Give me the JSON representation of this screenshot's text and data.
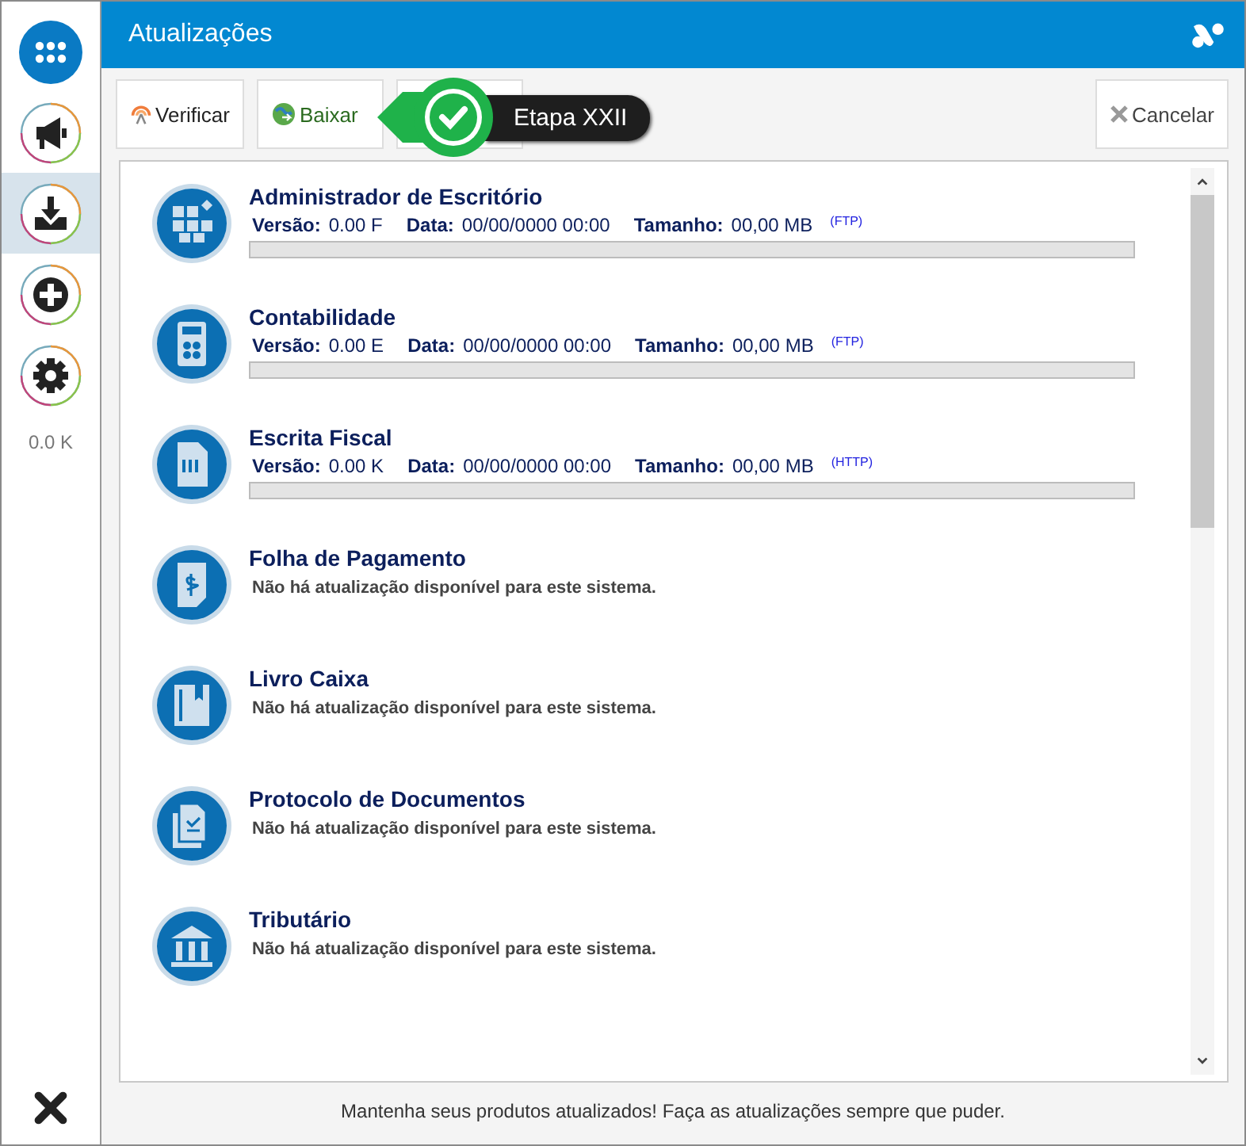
{
  "sidebar": {
    "items": [
      {
        "kind": "apps",
        "selected": false
      },
      {
        "kind": "megaphone",
        "selected": false
      },
      {
        "kind": "download",
        "selected": true
      },
      {
        "kind": "plus",
        "selected": false
      },
      {
        "kind": "gear",
        "selected": false
      }
    ],
    "usage": "0.0 K"
  },
  "window": {
    "title": "Atualizações"
  },
  "toolbar": {
    "buttons": [
      {
        "kind": "check",
        "label": "Verificar"
      },
      {
        "kind": "download",
        "label": "Baixar"
      },
      {
        "kind": "hidden"
      },
      {
        "kind": "cancel",
        "label": "Cancelar"
      }
    ]
  },
  "tooltip": {
    "text": "Etapa XXII"
  },
  "systems": [
    {
      "kind": "update",
      "name": "Administrador de Escritório",
      "fields": [
        {
          "label": "Versão:",
          "value": "0.00 F"
        },
        {
          "label": "Data:",
          "value": "00/00/0000 00:00"
        },
        {
          "label": "Tamanho:",
          "value": "00,00 MB"
        }
      ],
      "protocol": "(FTP)",
      "level": 0
    },
    {
      "kind": "update",
      "name": "Contabilidade",
      "fields": [
        {
          "label": "Versão:",
          "value": "0.00 E"
        },
        {
          "label": "Data:",
          "value": "00/00/0000 00:00"
        },
        {
          "label": "Tamanho:",
          "value": "00,00 MB"
        }
      ],
      "protocol": "(FTP)",
      "level": 0
    },
    {
      "kind": "update",
      "name": "Escrita Fiscal",
      "fields": [
        {
          "label": "Versão:",
          "value": "0.00 K"
        },
        {
          "label": "Data:",
          "value": "00/00/0000 00:00"
        },
        {
          "label": "Tamanho:",
          "value": "00,00 MB"
        }
      ],
      "protocol": "(HTTP)",
      "level": 0
    },
    {
      "kind": "none",
      "name": "Folha de Pagamento",
      "message": "Não há atualização disponível para este sistema."
    },
    {
      "kind": "none",
      "name": "Livro Caixa",
      "message": "Não há atualização disponível para este sistema."
    },
    {
      "kind": "none",
      "name": "Protocolo de Documentos",
      "message": "Não há atualização disponível para este sistema."
    },
    {
      "kind": "none",
      "name": "Tributário",
      "message": "Não há atualização disponível para este sistema."
    }
  ],
  "footer": "Mantenha seus produtos atualizados! Faça as atualizações sempre que puder."
}
